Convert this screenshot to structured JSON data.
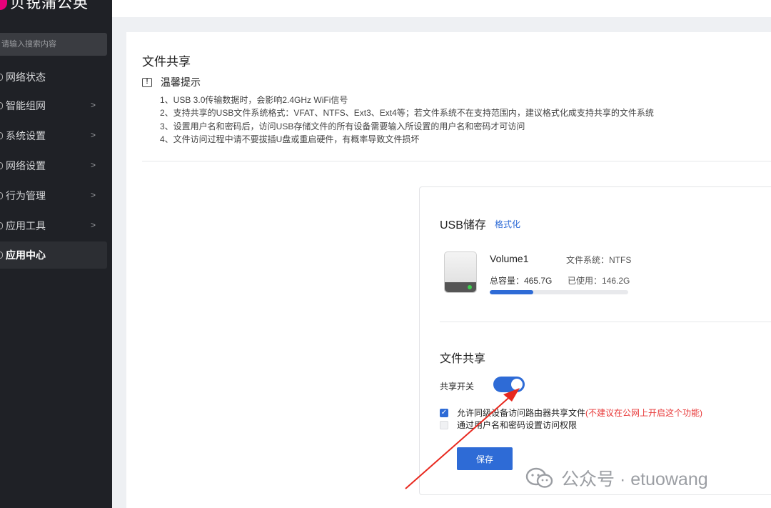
{
  "brand": {
    "name": "贝锐蒲公英",
    "accent": "#e6007a"
  },
  "search": {
    "placeholder": "请输入搜索内容"
  },
  "sidebar": {
    "items": [
      {
        "label": "网络状态",
        "has_arrow": false
      },
      {
        "label": "智能组网",
        "has_arrow": true
      },
      {
        "label": "系统设置",
        "has_arrow": true
      },
      {
        "label": "网络设置",
        "has_arrow": true
      },
      {
        "label": "行为管理",
        "has_arrow": true
      },
      {
        "label": "应用工具",
        "has_arrow": true
      },
      {
        "label": "应用中心",
        "has_arrow": false,
        "active": true
      }
    ],
    "chevron": ">"
  },
  "page": {
    "title": "文件共享",
    "tip_title": "温馨提示",
    "tip_icon": "info-icon",
    "tips": [
      "1、USB 3.0传输数据时，会影响2.4GHz WiFi信号",
      "2、支持共享的USB文件系统格式：VFAT、NTFS、Ext3、Ext4等；若文件系统不在支持范围内，建议格式化成支持共享的文件系统",
      "3、设置用户名和密码后，访问USB存储文件的所有设备需要输入所设置的用户名和密码才可访问",
      "4、文件访问过程中请不要拔插U盘或重启硬件，有概率导致文件损坏"
    ]
  },
  "usb": {
    "title": "USB储存",
    "format_link": "格式化",
    "volume_name": "Volume1",
    "filesystem": "文件系统：NTFS",
    "capacity": "总容量：465.7G",
    "used": "已使用：146.2G",
    "used_fraction": 0.314
  },
  "share": {
    "title": "文件共享",
    "switch_label": "共享开关",
    "switch_on": true,
    "option1_label": "允许同级设备访问路由器共享文件",
    "option1_warning": "(不建议在公网上开启这个功能)",
    "option1_checked": true,
    "option2_label": "通过用户名和密码设置访问权限",
    "option2_checked": false,
    "save_label": "保存"
  },
  "watermark": {
    "text": "公众号 · etuowang"
  },
  "colors": {
    "primary": "#2e6bd6",
    "sidebar_bg": "#1f2126",
    "warning": "#e83a3a",
    "annotation": "#e8281e"
  }
}
